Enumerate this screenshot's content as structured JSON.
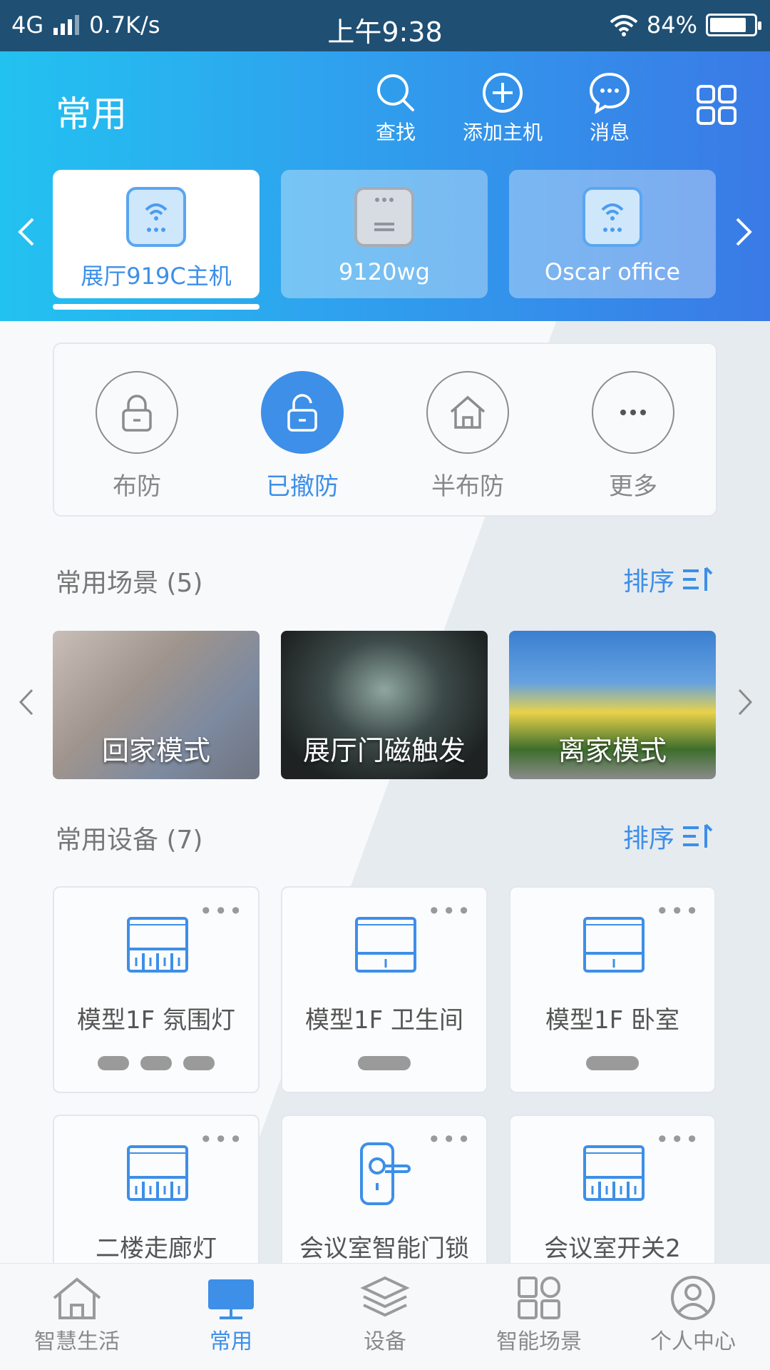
{
  "status_bar": {
    "network": "4G",
    "speed": "0.7K/s",
    "time": "上午9:38",
    "battery": "84%",
    "battery_level": 0.84
  },
  "header": {
    "title": "常用",
    "actions": [
      {
        "label": "查找",
        "icon": "search-icon"
      },
      {
        "label": "添加主机",
        "icon": "add-circle-icon"
      },
      {
        "label": "消息",
        "icon": "message-icon"
      }
    ],
    "grid_icon": "grid-icon",
    "hosts": [
      {
        "label": "展厅919C主机",
        "icon": "wifi-host-icon",
        "selected": true
      },
      {
        "label": "9120wg",
        "icon": "gateway-icon",
        "selected": false
      },
      {
        "label": "Oscar office",
        "icon": "wifi-host-icon",
        "selected": false
      }
    ]
  },
  "arming": {
    "items": [
      {
        "label": "布防",
        "icon": "lock-icon",
        "active": false
      },
      {
        "label": "已撤防",
        "icon": "unlock-icon",
        "active": true
      },
      {
        "label": "半布防",
        "icon": "home-icon",
        "active": false
      },
      {
        "label": "更多",
        "icon": "more-icon",
        "active": false
      }
    ]
  },
  "scenes": {
    "title": "常用场景 (5)",
    "sort_label": "排序",
    "items": [
      {
        "label": "回家模式"
      },
      {
        "label": "展厅门磁触发"
      },
      {
        "label": "离家模式"
      }
    ]
  },
  "devices": {
    "title": "常用设备 (7)",
    "sort_label": "排序",
    "more": "•••",
    "items": [
      {
        "name": "模型1F 氛围灯",
        "icon": "switch-panel-icon"
      },
      {
        "name": "模型1F 卫生间",
        "icon": "switch-panel-icon"
      },
      {
        "name": "模型1F 卧室",
        "icon": "switch-panel-icon"
      },
      {
        "name": "二楼走廊灯",
        "icon": "switch-panel-icon"
      },
      {
        "name": "会议室智能门锁",
        "icon": "door-lock-icon"
      },
      {
        "name": "会议室开关2",
        "icon": "switch-panel-icon"
      }
    ]
  },
  "tabbar": {
    "items": [
      {
        "label": "智慧生活",
        "icon": "home-icon"
      },
      {
        "label": "常用",
        "icon": "monitor-icon",
        "active": true
      },
      {
        "label": "设备",
        "icon": "layers-icon"
      },
      {
        "label": "智能场景",
        "icon": "grid-icon"
      },
      {
        "label": "个人中心",
        "icon": "user-icon"
      }
    ]
  },
  "colors": {
    "accent": "#3d8fe8",
    "header_start": "#22c2f0",
    "header_end": "#3a7ae6"
  }
}
